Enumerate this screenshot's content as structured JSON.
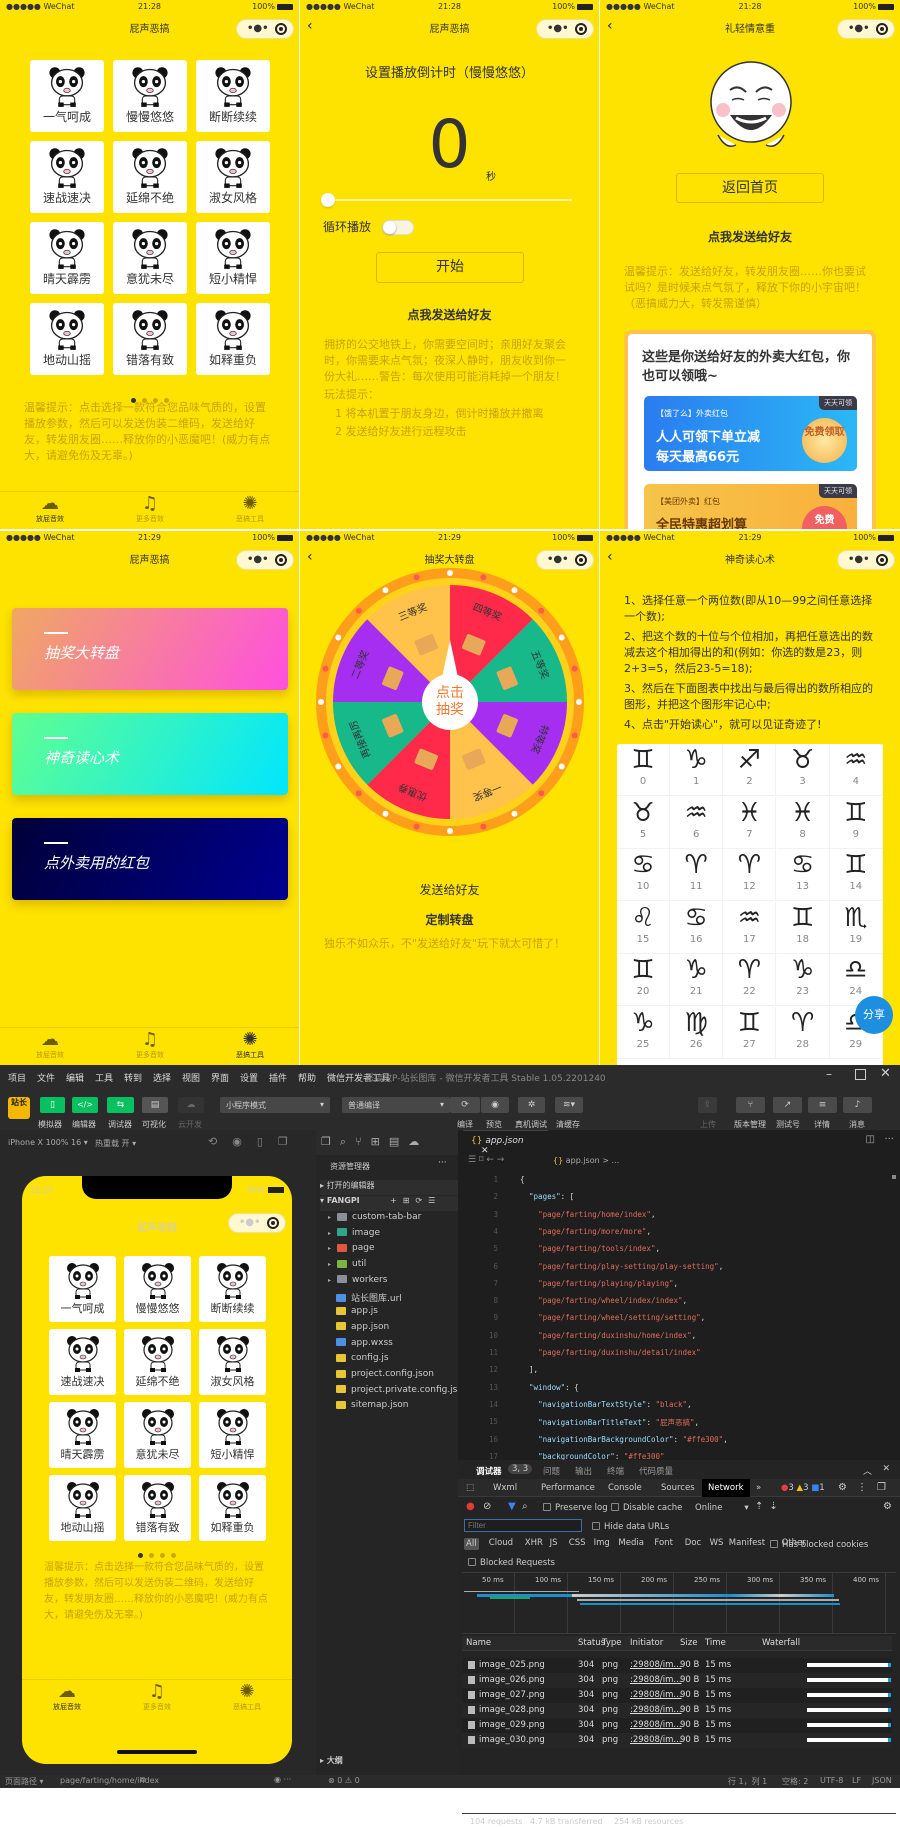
{
  "status": {
    "carrier": "●●●●● WeChat",
    "battery": "100%"
  },
  "colors": {
    "yellow": "#ffe300",
    "hint": "#c4a400",
    "ide_bg": "#2b2b2b",
    "green_btn": "#07c160"
  },
  "home": {
    "time": "21:28",
    "title": "屁声恶搞",
    "sounds": [
      "一气呵成",
      "慢慢悠悠",
      "断断续续",
      "速战速决",
      "延绵不绝",
      "淑女风格",
      "晴天霹雳",
      "意犹未尽",
      "短小精悍",
      "地动山摇",
      "错落有致",
      "如释重负"
    ],
    "page_index": 1,
    "page_count": 4,
    "hint": "温馨提示：点击选择一款符合您品味气质的，设置播放参数，然后可以发送伪装二维码，发送给好友，转发朋友圈……释放你的小恶魔吧！(威力有点大，请避免伤及无辜。)",
    "tabs": [
      {
        "label": "放屁音效",
        "icon": "cloud-icon",
        "active": true
      },
      {
        "label": "更多音效",
        "icon": "music-note-icon",
        "active": false
      },
      {
        "label": "恶搞工具",
        "icon": "wheel-icon",
        "active": false
      }
    ]
  },
  "setting": {
    "time": "21:28",
    "title": "屁声恶搞",
    "heading": "设置播放倒计时（慢慢悠悠）",
    "count": "0",
    "unit": "秒",
    "slider_value": 0,
    "loop_label": "循环播放",
    "loop_on": false,
    "start": "开始",
    "share": "点我发送给好友",
    "desc": "拥挤的公交地铁上，你需要空间时；亲朋好友聚会时，你需要来点气氛；夜深人静时，朋友收到你一份大礼……警告：每次使用可能消耗掉一个朋友！",
    "tips_title": "玩法提示：",
    "tips": [
      "1 将本机置于朋友身边，倒计时播放并撤离",
      "2 发送给好友进行远程攻击"
    ]
  },
  "result": {
    "time": "21:28",
    "title": "礼轻情意重",
    "back": "返回首页",
    "share": "点我发送给好友",
    "hint": "温馨提示：发送给好友，转发朋友圈……你也要试试吗？是时候来点气氛了，释放下你的小宇宙吧！（恶搞威力大，转发需谨慎）",
    "card_title": "这些是你送给好友的外卖大红包，你也可以领哦~",
    "coupons": [
      {
        "brand": "【饿了么】外卖红包",
        "badge": "天天可领",
        "line1": "人人可领下单立减",
        "line2": "每天最高66元",
        "button": "免费领取"
      },
      {
        "brand": "【美团外卖】红包",
        "badge": "天天可领",
        "line1": "全民特惠超划算",
        "button": "免费"
      }
    ]
  },
  "tools": {
    "time": "21:29",
    "title": "屁声恶搞",
    "cards": [
      "抽奖大转盘",
      "神奇读心术",
      "点外卖用的红包"
    ],
    "tabs": [
      {
        "label": "放屁音效",
        "active": false
      },
      {
        "label": "更多音效",
        "active": false
      },
      {
        "label": "恶搞工具",
        "active": true
      }
    ]
  },
  "wheel": {
    "time": "21:29",
    "title": "抽奖大转盘",
    "center": [
      "点击",
      "抽奖"
    ],
    "prizes": [
      {
        "label": "四等奖",
        "color": "#ff2a4a"
      },
      {
        "label": "五等奖",
        "color": "#17b88a"
      },
      {
        "label": "特等奖",
        "color": "#a52ef0"
      },
      {
        "label": "一等奖",
        "color": "#ffc24a"
      },
      {
        "label": "优惠券",
        "color": "#ff2a4a"
      },
      {
        "label": "再接再厉",
        "color": "#17b88a"
      },
      {
        "label": "二等奖",
        "color": "#a52ef0"
      },
      {
        "label": "三等奖",
        "color": "#ffc24a"
      }
    ],
    "send": "发送给好友",
    "custom": "定制转盘",
    "tip": "独乐不如众乐，不\"发送给好友\"玩下就太可惜了！"
  },
  "mind": {
    "time": "21:29",
    "title": "神奇读心术",
    "steps": [
      "1、选择任意一个两位数(即从10—99之间任意选择一个数);",
      "2、把这个数的十位与个位相加，再把任意选出的数减去这个相加得出的和(例如：你选的数是23，则2+3=5，然后23-5=18);",
      "3、然后在下面图表中找出与最后得出的数所相应的图形，并把这个图形牢记心中;",
      "4、点击\"开始读心\"，就可以见证奇迹了!"
    ],
    "symbols": [
      "♊",
      "♑",
      "♐",
      "♉",
      "♒",
      "♉",
      "♒",
      "♓",
      "♓",
      "♊",
      "♋",
      "♈",
      "♈",
      "♋",
      "♊",
      "♌",
      "♋",
      "♒",
      "♊",
      "♏",
      "♊",
      "♑",
      "♈",
      "♑",
      "♎",
      "♑",
      "♍",
      "♊",
      "♈",
      "♎"
    ],
    "share": "分享"
  },
  "ide": {
    "menu": [
      "项目",
      "文件",
      "编辑",
      "工具",
      "转到",
      "选择",
      "视图",
      "界面",
      "设置",
      "插件",
      "帮助",
      "微信开发者工具"
    ],
    "window_title": "恶搞放P-站长图库 - 微信开发者工具 Stable 1.05.2201240",
    "logo": "站长",
    "left_tools": [
      "模拟器",
      "编辑器",
      "调试器",
      "可视化",
      "云开发"
    ],
    "mode": "小程序模式",
    "compile": "普通编译",
    "mid_tools": [
      "编译",
      "预览",
      "真机调试",
      "清缓存"
    ],
    "right_tools": [
      "上传",
      "版本管理",
      "测试号",
      "详情",
      "消息"
    ],
    "device": "iPhone X 100% 16 ▾",
    "hot_reload": "热重载 开 ▾",
    "sim": {
      "time": "21:27",
      "battery": "100%",
      "title": "屁声恶搞",
      "hint": "温馨提示：点击选择一款符合您品味气质的，设置播放参数，然后可以发送伪装二维码，发送给好友，转发朋友圈……释放你的小恶魔吧！(威力有点大，请避免伤及无辜。)"
    },
    "explorer": {
      "title": "资源管理器",
      "open_editors": "打开的编辑器",
      "project": "FANGPI",
      "items": [
        {
          "name": "custom-tab-bar",
          "type": "folder",
          "color": "#8a8f99"
        },
        {
          "name": "image",
          "type": "folder",
          "color": "#2fa58a"
        },
        {
          "name": "page",
          "type": "folder",
          "color": "#e0573f"
        },
        {
          "name": "util",
          "type": "folder",
          "color": "#7cb342"
        },
        {
          "name": "workers",
          "type": "folder",
          "color": "#8a8f99"
        },
        {
          "name": "站长图库.url",
          "type": "link",
          "color": "#4f8fe0"
        },
        {
          "name": "app.js",
          "type": "js",
          "color": "#e8c534"
        },
        {
          "name": "app.json",
          "type": "json",
          "color": "#e8c534"
        },
        {
          "name": "app.wxss",
          "type": "css",
          "color": "#4f8fe0"
        },
        {
          "name": "config.js",
          "type": "js",
          "color": "#e8c534"
        },
        {
          "name": "project.config.json",
          "type": "json",
          "color": "#e8c534"
        },
        {
          "name": "project.private.config.js...",
          "type": "json",
          "color": "#e8c534"
        },
        {
          "name": "sitemap.json",
          "type": "json",
          "color": "#e8c534"
        }
      ],
      "outline": "大纲",
      "errors": "⊗ 0 ⚠ 0"
    },
    "editor": {
      "tab": "app.json",
      "breadcrumb": "app.json > ...",
      "lines": [
        "{",
        "  \"pages\": [",
        "    \"page/farting/home/index\",",
        "    \"page/farting/more/more\",",
        "    \"page/farting/tools/index\",",
        "    \"page/farting/play-setting/play-setting\",",
        "    \"page/farting/playing/playing\",",
        "    \"page/farting/wheel/index/index\",",
        "    \"page/farting/wheel/setting/setting\",",
        "    \"page/farting/duxinshu/home/index\",",
        "    \"page/farting/duxinshu/detail/index\"",
        "  ],",
        "  \"window\": {",
        "    \"navigationBarTextStyle\": \"black\",",
        "    \"navigationBarTitleText\": \"屁声恶搞\",",
        "    \"navigationBarBackgroundColor\": \"#ffe300\",",
        "    \"backgroundColor\": \"#ffe300\""
      ]
    },
    "debugger": {
      "tabs": [
        "调试器",
        "问题",
        "输出",
        "终端",
        "代码质量"
      ],
      "badge": "3, 3",
      "devtools_tabs": [
        "Wxml",
        "Performance",
        "Console",
        "Sources",
        "Network",
        "»"
      ],
      "active_tab": "Network",
      "errors": "3",
      "warnings": "3",
      "infos": "1",
      "preserve_log": "Preserve log",
      "disable_cache": "Disable cache",
      "throttle": "Online",
      "filter_placeholder": "Filter",
      "hide_data_urls": "Hide data URLs",
      "types": [
        "All",
        "Cloud",
        "XHR",
        "JS",
        "CSS",
        "Img",
        "Media",
        "Font",
        "Doc",
        "WS",
        "Manifest",
        "Other"
      ],
      "blocked_cookies": "Has blocked cookies",
      "blocked_requests": "Blocked Requests",
      "timeline": [
        "50 ms",
        "100 ms",
        "150 ms",
        "200 ms",
        "250 ms",
        "300 ms",
        "350 ms",
        "400 ms"
      ],
      "columns": [
        "Name",
        "Status",
        "Type",
        "Initiator",
        "Size",
        "Time",
        "Waterfall"
      ],
      "rows": [
        {
          "name": "image_025.png",
          "status": "304",
          "type": "png",
          "initiator": ":29808/im...",
          "size": "90 B",
          "time": "15 ms"
        },
        {
          "name": "image_026.png",
          "status": "304",
          "type": "png",
          "initiator": ":29808/im...",
          "size": "90 B",
          "time": "15 ms"
        },
        {
          "name": "image_027.png",
          "status": "304",
          "type": "png",
          "initiator": ":29808/im...",
          "size": "90 B",
          "time": "15 ms"
        },
        {
          "name": "image_028.png",
          "status": "304",
          "type": "png",
          "initiator": ":29808/im...",
          "size": "90 B",
          "time": "15 ms"
        },
        {
          "name": "image_029.png",
          "status": "304",
          "type": "png",
          "initiator": ":29808/im...",
          "size": "90 B",
          "time": "15 ms"
        },
        {
          "name": "image_030.png",
          "status": "304",
          "type": "png",
          "initiator": ":29808/im...",
          "size": "90 B",
          "time": "15 ms"
        }
      ],
      "summary": [
        "104 requests",
        "4.7 kB transferred",
        "254 kB resources"
      ]
    },
    "statusbar": {
      "page_path_label": "页面路径 ▾",
      "page_path": "page/farting/home/index",
      "cursor": "行 1，列 1",
      "spaces": "空格: 2",
      "encoding": "UTF-8",
      "eol": "LF",
      "language": "JSON"
    }
  }
}
